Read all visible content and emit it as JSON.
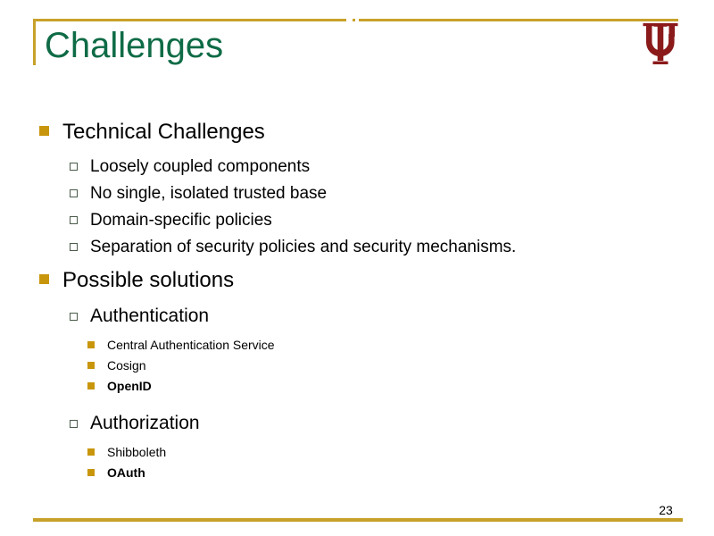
{
  "slide": {
    "title": "Challenges",
    "page_number": "23",
    "logo_name": "indiana-university-trident-logo",
    "colors": {
      "title_green": "#0E6B46",
      "accent_gold": "#C8A12A",
      "bullet_gold": "#C8960C",
      "link_blue": "#1F45B0",
      "logo_crimson": "#8B1A1A",
      "body_text": "#000000"
    }
  },
  "content": {
    "sections": [
      {
        "heading": "Technical Challenges",
        "items": [
          "Loosely coupled components",
          "No single, isolated trusted base",
          "Domain-specific policies",
          "Separation of security policies and security mechanisms."
        ]
      },
      {
        "heading": "Possible solutions",
        "groups": [
          {
            "label": "Authentication",
            "items": [
              {
                "text": "Central Authentication Service",
                "link": false
              },
              {
                "text": "Cosign",
                "link": false
              },
              {
                "text": "OpenID",
                "link": true
              }
            ]
          },
          {
            "label": "Authorization",
            "items": [
              {
                "text": "Shibboleth",
                "link": false
              },
              {
                "text": "OAuth",
                "link": true
              }
            ]
          }
        ]
      }
    ]
  }
}
